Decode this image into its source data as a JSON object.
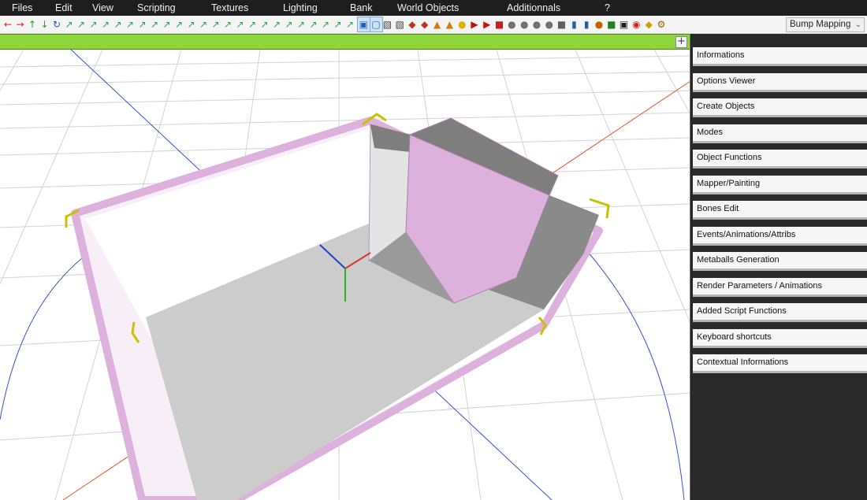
{
  "menubar": {
    "items": [
      {
        "label": "Files"
      },
      {
        "label": "Edit"
      },
      {
        "label": "View"
      },
      {
        "label": "Scripting"
      },
      {
        "label": "Textures"
      },
      {
        "label": "Lighting"
      },
      {
        "label": "Bank"
      },
      {
        "label": "World Objects"
      },
      {
        "label": "Additionnals"
      },
      {
        "label": "?"
      }
    ]
  },
  "toolbar": {
    "icons": [
      "arrow-left-icon",
      "arrow-right-icon",
      "arrow-up-icon",
      "arrow-down-icon",
      "rotate-icon",
      "axis-icon",
      "axis-icon",
      "axis-icon",
      "axis-icon",
      "axis-icon",
      "axis-icon",
      "axis-icon",
      "axis-icon",
      "axis-icon",
      "axis-icon",
      "axis-icon",
      "axis-icon",
      "axis-icon",
      "axis-icon",
      "axis-icon",
      "axis-icon",
      "axis-icon",
      "axis-icon",
      "axis-icon",
      "axis-icon",
      "axis-icon",
      "axis-icon",
      "axis-icon",
      "axis-icon",
      "select-vertex-icon",
      "select-face-icon",
      "cube-icon",
      "cube-icon",
      "shape-icon",
      "shape-icon",
      "cone-icon",
      "cone-icon",
      "light-bulb-icon",
      "flag-icon",
      "play-icon",
      "paint-icon",
      "sprite-icon",
      "sprite-icon",
      "sprite-icon",
      "sprite-icon",
      "hand-icon",
      "bottle-icon",
      "bottle-icon",
      "pin-icon",
      "chip-icon",
      "film-icon",
      "target-icon",
      "diamond-icon",
      "gear-icon"
    ],
    "render_mode": {
      "selected": "Bump Mapping"
    }
  },
  "side_panel": {
    "items": [
      {
        "label": "Informations"
      },
      {
        "label": "Options Viewer"
      },
      {
        "label": "Create Objects"
      },
      {
        "label": "Modes"
      },
      {
        "label": "Object Functions"
      },
      {
        "label": "Mapper/Painting"
      },
      {
        "label": "Bones Edit"
      },
      {
        "label": "Events/Animations/Attribs"
      },
      {
        "label": "Metaballs Generation"
      },
      {
        "label": "Render Parameters / Animations"
      },
      {
        "label": "Added Script Functions"
      },
      {
        "label": "Keyboard shortcuts"
      },
      {
        "label": "Contextual Informations"
      }
    ]
  },
  "viewport": {
    "corner_button": "+",
    "colors": {
      "header_bar": "#8fd43a",
      "grid": "#d0d0d0",
      "wall_pink": "#dcb2dc",
      "floor_gray": "#cccccc",
      "dark_face": "#7e7e7e",
      "circle_blue": "#3a4ed0",
      "axis_red": "#e05030",
      "handles_yellow": "#c9c200"
    }
  }
}
